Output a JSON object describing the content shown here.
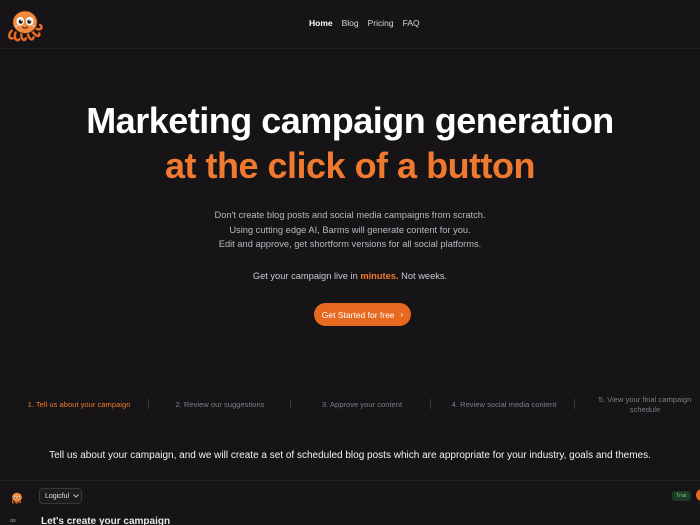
{
  "nav": {
    "items": [
      {
        "label": "Home",
        "active": true
      },
      {
        "label": "Blog",
        "active": false
      },
      {
        "label": "Pricing",
        "active": false
      },
      {
        "label": "FAQ",
        "active": false
      }
    ]
  },
  "hero": {
    "line1": "Marketing campaign generation",
    "line2": "at the click of a button",
    "desc": [
      "Don't create blog posts and social media campaigns from scratch.",
      "Using cutting edge AI, Barms will generate content for you.",
      "Edit and approve, get shortform versions for all social platforms."
    ],
    "live_prefix": "Get your campaign live in ",
    "live_highlight": "minutes.",
    "live_suffix": " Not weeks.",
    "cta_label": "Get Started for free",
    "cta_icon": "chevron-right-icon"
  },
  "steps": [
    {
      "label": "1. Tell us about your campaign",
      "active": true
    },
    {
      "label": "2. Review our suggestions",
      "active": false
    },
    {
      "label": "3. Approve your content",
      "active": false
    },
    {
      "label": "4. Review social media content",
      "active": false
    },
    {
      "label": "5. View your final campaign schedule",
      "active": false
    }
  ],
  "tell_text": "Tell us about your campaign, and we will create a set of scheduled blog posts which are appropriate for your industry, goals and themes.",
  "app": {
    "select_value": "Logicful",
    "trial_badge": "Trial",
    "heading": "Let's create your campaign"
  },
  "colors": {
    "accent": "#ef7a2f",
    "background": "#161417"
  }
}
